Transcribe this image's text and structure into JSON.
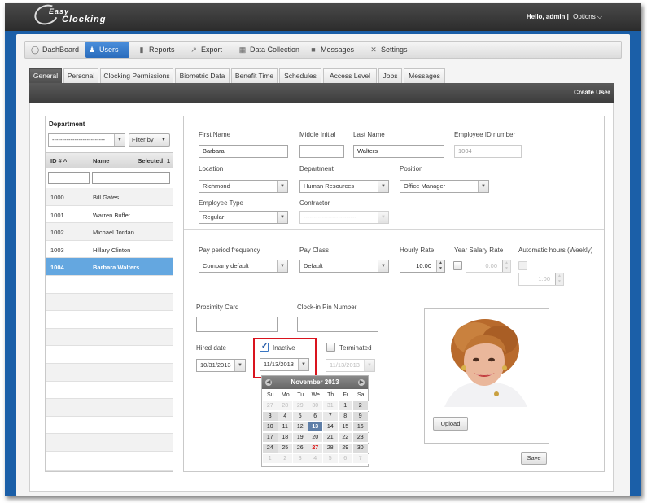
{
  "header": {
    "logo_top": "Easy",
    "logo_bottom": "Clocking",
    "greeting": "Hello, admin |",
    "options": "Options ⌵"
  },
  "nav": {
    "items": [
      {
        "label": "DashBoard",
        "icon": "dashboard-icon"
      },
      {
        "label": "Users",
        "icon": "user-icon"
      },
      {
        "label": "Reports",
        "icon": "bar-chart-icon"
      },
      {
        "label": "Export",
        "icon": "export-icon"
      },
      {
        "label": "Data Collection",
        "icon": "data-collection-icon"
      },
      {
        "label": "Messages",
        "icon": "message-icon"
      },
      {
        "label": "Settings",
        "icon": "tools-icon"
      }
    ],
    "active": "Users"
  },
  "tabs": [
    "General",
    "Personal",
    "Clocking Permissions",
    "Biometric Data",
    "Benefit Time",
    "Schedules",
    "Access Level",
    "Jobs",
    "Messages"
  ],
  "active_tab": "General",
  "create_user": "Create User",
  "left": {
    "department_label": "Department",
    "department_value": "--------------------------",
    "filter_label": "Filter by",
    "col_id": "ID # ˄",
    "col_name": "Name",
    "selected_text": "Selected: 1",
    "rows": [
      {
        "id": "1000",
        "name": "Bill Gates"
      },
      {
        "id": "1001",
        "name": "Warren Buffet"
      },
      {
        "id": "1002",
        "name": "Michael Jordan"
      },
      {
        "id": "1003",
        "name": "Hillary Clinton"
      },
      {
        "id": "1004",
        "name": "Barbara Walters"
      }
    ],
    "selected_id": "1004"
  },
  "form": {
    "first_name_label": "First Name",
    "first_name": "Barbara",
    "middle_initial_label": "Middle Initial",
    "middle_initial": "",
    "last_name_label": "Last Name",
    "last_name": "Walters",
    "employee_id_label": "Employee ID number",
    "employee_id": "1004",
    "location_label": "Location",
    "location": "Richmond",
    "department_label": "Department",
    "department": "Human Resources",
    "position_label": "Position",
    "position": "Office Manager",
    "employee_type_label": "Employee Type",
    "employee_type": "Regular",
    "contractor_label": "Contractor",
    "contractor": "--------------------------",
    "pay_period_label": "Pay period frequency",
    "pay_period": "Company default",
    "pay_class_label": "Pay Class",
    "pay_class": "Default",
    "hourly_rate_label": "Hourly Rate",
    "hourly_rate": "10.00",
    "year_salary_label": "Year Salary Rate",
    "year_salary": "0.00",
    "auto_hours_label": "Automatic hours (Weekly)",
    "auto_hours": "1.00",
    "proximity_label": "Proximity Card",
    "proximity": "",
    "pin_label": "Clock-in Pin Number",
    "pin": "",
    "hired_label": "Hired date",
    "hired": "10/31/2013",
    "inactive_label": "Inactive",
    "inactive_checked": true,
    "inactive_date": "11/13/2013",
    "terminated_label": "Terminated",
    "terminated_date": "11/13/2013",
    "upload": "Upload",
    "save": "Save"
  },
  "calendar": {
    "title": "November 2013",
    "dows": [
      "Su",
      "Mo",
      "Tu",
      "We",
      "Th",
      "Fr",
      "Sa"
    ],
    "weeks": [
      [
        "27",
        "28",
        "29",
        "30",
        "31",
        "1",
        "2"
      ],
      [
        "3",
        "4",
        "5",
        "6",
        "7",
        "8",
        "9"
      ],
      [
        "10",
        "11",
        "12",
        "13",
        "14",
        "15",
        "16"
      ],
      [
        "17",
        "18",
        "19",
        "20",
        "21",
        "22",
        "23"
      ],
      [
        "24",
        "25",
        "26",
        "27",
        "28",
        "29",
        "30"
      ],
      [
        "1",
        "2",
        "3",
        "4",
        "5",
        "6",
        "7"
      ]
    ],
    "selected": "13",
    "today": "27"
  },
  "colors": {
    "frame": "#1b5fa8",
    "active_nav": "#2a6cbc",
    "selected_row": "#64a7e0",
    "highlight": "#d9141e"
  }
}
